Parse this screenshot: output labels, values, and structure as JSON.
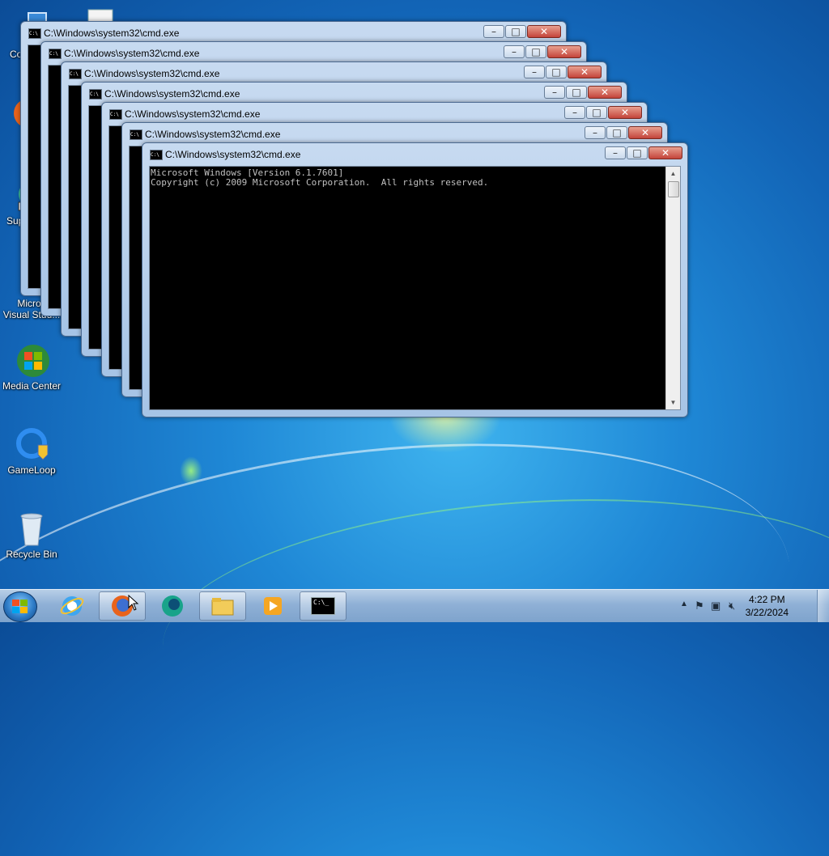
{
  "desktop": {
    "icons": [
      {
        "label": "Co"
      },
      {
        "label": ""
      },
      {
        "label": "F"
      },
      {
        "label": "Sup"
      },
      {
        "label": "Micros\nVisual Stud..."
      },
      {
        "label": "Media Center"
      },
      {
        "label": "GameLoop"
      },
      {
        "label": "Recycle Bin"
      }
    ]
  },
  "windows": [
    {
      "title": "C:\\Windows\\system32\\cmd.exe"
    },
    {
      "title": "C:\\Windows\\system32\\cmd.exe"
    },
    {
      "title": "C:\\Windows\\system32\\cmd.exe"
    },
    {
      "title": "C:\\Windows\\system32\\cmd.exe"
    },
    {
      "title": "C:\\Windows\\system32\\cmd.exe"
    },
    {
      "title": "C:\\Windows\\system32\\cmd.exe"
    },
    {
      "title": "C:\\Windows\\system32\\cmd.exe",
      "console_lines": [
        "Microsoft Windows [Version 6.1.7601]",
        "Copyright (c) 2009 Microsoft Corporation.  All rights reserved."
      ]
    }
  ],
  "controls": {
    "minimize": "–",
    "maximize": "□",
    "close": "✕"
  },
  "taskbar": {
    "items": [
      {
        "name": "Internet Explorer",
        "icon": "ie-icon"
      },
      {
        "name": "Firefox",
        "icon": "firefox-icon"
      },
      {
        "name": "App",
        "icon": "app-icon"
      },
      {
        "name": "Windows Explorer",
        "icon": "folder-icon"
      },
      {
        "name": "Windows Media Player",
        "icon": "media-player-icon"
      },
      {
        "name": "Command Prompt",
        "icon": "cmd-icon"
      }
    ],
    "cmd_icon_text": "C:\\_",
    "clock_time": "4:22 PM",
    "clock_date": "3/22/2024"
  },
  "colors": {
    "accent": "#1f88d6",
    "close": "#c4443a",
    "console_bg": "#000000"
  }
}
